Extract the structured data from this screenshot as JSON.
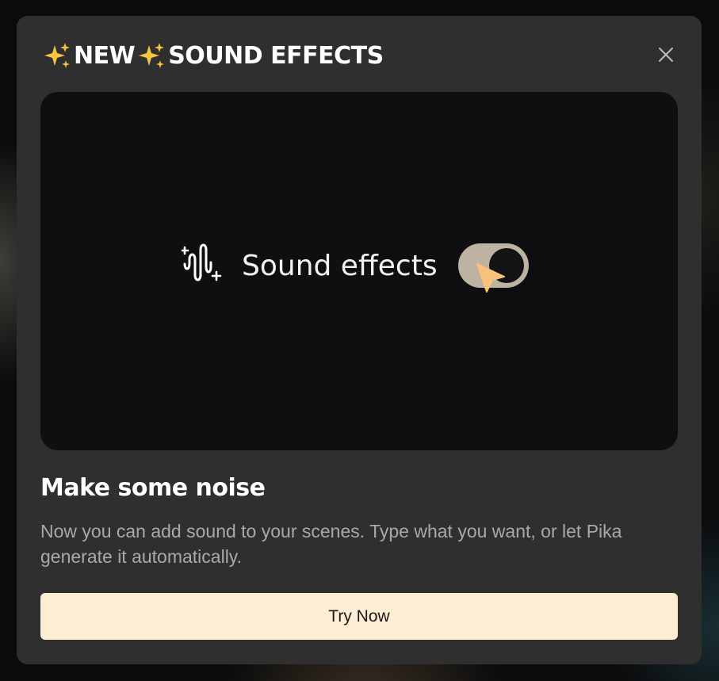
{
  "modal": {
    "title_word_1": "NEW",
    "title_word_2": "SOUND EFFECTS",
    "title_icons": [
      "sparkles-icon",
      "sparkles-icon"
    ],
    "close_icon": "close-icon",
    "preview": {
      "icon": "sound-wave-sparkle-icon",
      "label": "Sound effects",
      "toggle_state": "on",
      "cursor_icon": "pointer-cursor-icon"
    },
    "headline": "Make some noise",
    "description": "Now you can add sound to your scenes. Type what you want, or let Pika generate it automatically.",
    "cta_label": "Try Now"
  },
  "colors": {
    "modal_bg": "#2f2f2f",
    "preview_bg": "#0f0e10",
    "button_bg": "#fdedd3",
    "sparkle_yellow": "#f6c543",
    "toggle_track": "#beb3a3",
    "cursor_fill": "#f8c27a"
  }
}
